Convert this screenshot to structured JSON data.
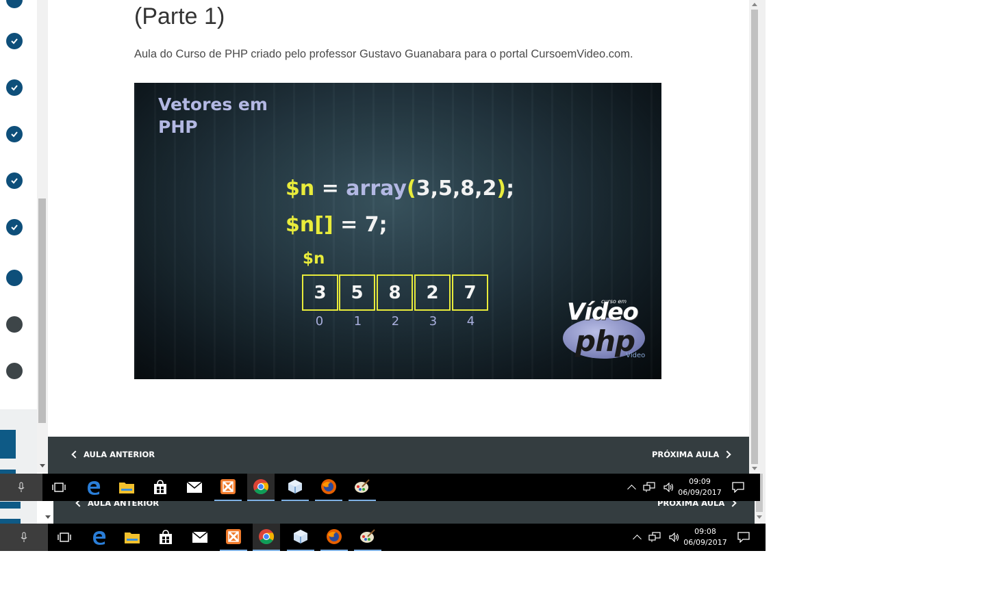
{
  "lesson": {
    "title": "(Parte 1)",
    "description": "Aula do Curso de PHP criado pelo professor Gustavo Guanabara para o portal CursoemVideo.com."
  },
  "sidebar": {
    "lessons": [
      {
        "status": "completed"
      },
      {
        "status": "completed"
      },
      {
        "status": "completed"
      },
      {
        "status": "completed"
      },
      {
        "status": "completed"
      },
      {
        "status": "current"
      },
      {
        "status": "not-started"
      },
      {
        "status": "not-started"
      }
    ]
  },
  "video": {
    "heading_line1": "Vetores em",
    "heading_line2": "PHP",
    "code_line1": {
      "var": "$n",
      "eq": "=",
      "fn": "array",
      "open": "(",
      "args": "3,5,8,2",
      "close": ")",
      "end": ";"
    },
    "code_line2": {
      "var": "$n[]",
      "eq": "=",
      "val": "7;"
    },
    "array_label": "$n",
    "array_values": [
      "3",
      "5",
      "8",
      "2",
      "7"
    ],
    "array_indices": [
      "0",
      "1",
      "2",
      "3",
      "4"
    ],
    "logo_top": "curso em",
    "logo_video": "Vídeo",
    "logo_php": "php",
    "logo_bottom": "Vídeo"
  },
  "navigation": {
    "previous_label": "AULA ANTERIOR",
    "next_label": "PRÓXIMA AULA"
  },
  "taskbar_front": {
    "time": "09:09",
    "date": "06/09/2017",
    "apps": [
      "cortana-mic-icon",
      "task-view-icon",
      "edge-icon",
      "file-explorer-icon",
      "store-icon",
      "mail-icon",
      "xampp-icon",
      "chrome-icon",
      "virtualbox-icon",
      "firefox-icon",
      "paint-icon"
    ]
  },
  "taskbar_back": {
    "time": "09:08",
    "date": "06/09/2017"
  },
  "colors": {
    "accent": "#0e4f7a",
    "nav_bg": "#343d40",
    "code_yellow": "#e9ec3b",
    "code_lavender": "#b3b8e3"
  }
}
